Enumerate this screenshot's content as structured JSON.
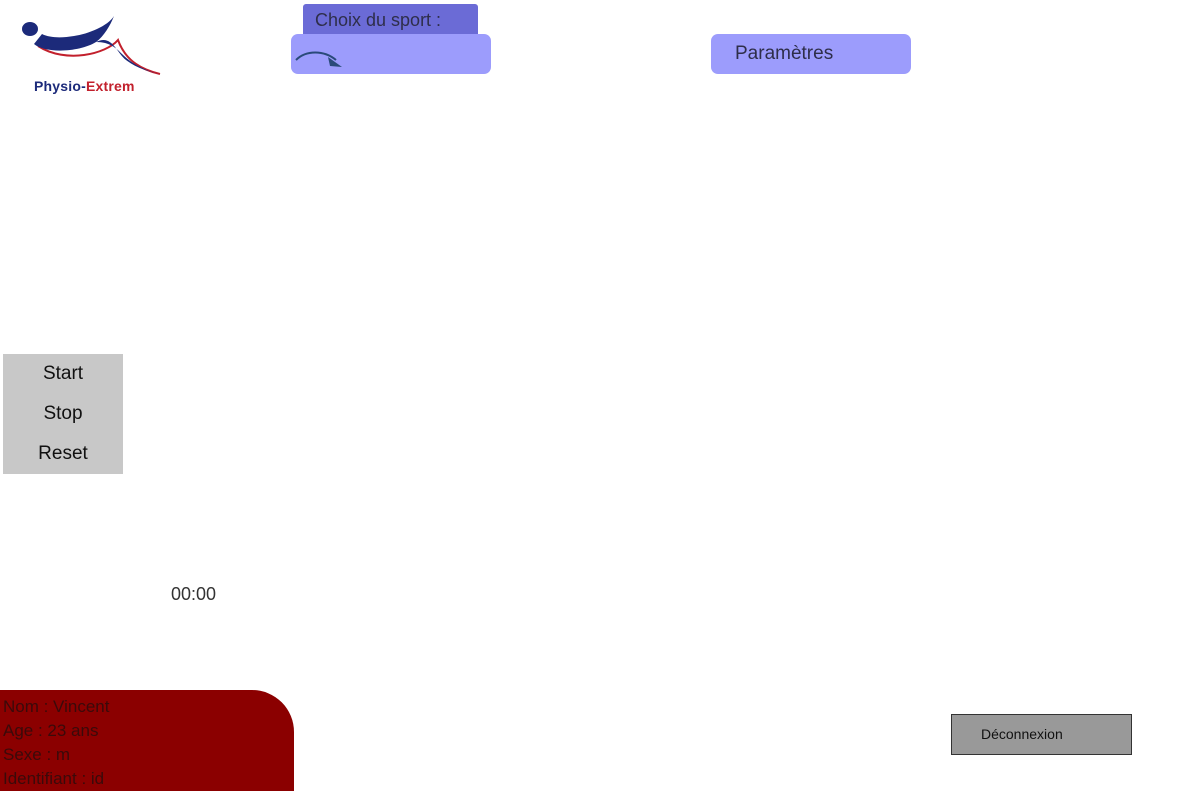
{
  "logo": {
    "text_part1": "Physio",
    "text_separator": "-",
    "text_part2": "Extrem",
    "colors": {
      "primary": "#1c2a7a",
      "accent": "#c2202c"
    }
  },
  "sport": {
    "label": "Choix du sport :",
    "selected": "",
    "icon": "curved-arrow-icon"
  },
  "settings": {
    "label": "Paramètres"
  },
  "controls": {
    "start": "Start",
    "stop": "Stop",
    "reset": "Reset"
  },
  "timer": {
    "value": "00:00"
  },
  "user": {
    "nom": "Nom : Vincent",
    "age": "Age : 23 ans",
    "sexe": "Sexe : m",
    "identifiant": "Identifiant : id"
  },
  "logout": {
    "label": "Déconnexion"
  },
  "colors": {
    "tab": "#6b6bd6",
    "button": "#9c9cfc",
    "controls_bg": "#c8c8c8",
    "user_card": "#8b0000",
    "logout_bg": "#999999"
  }
}
